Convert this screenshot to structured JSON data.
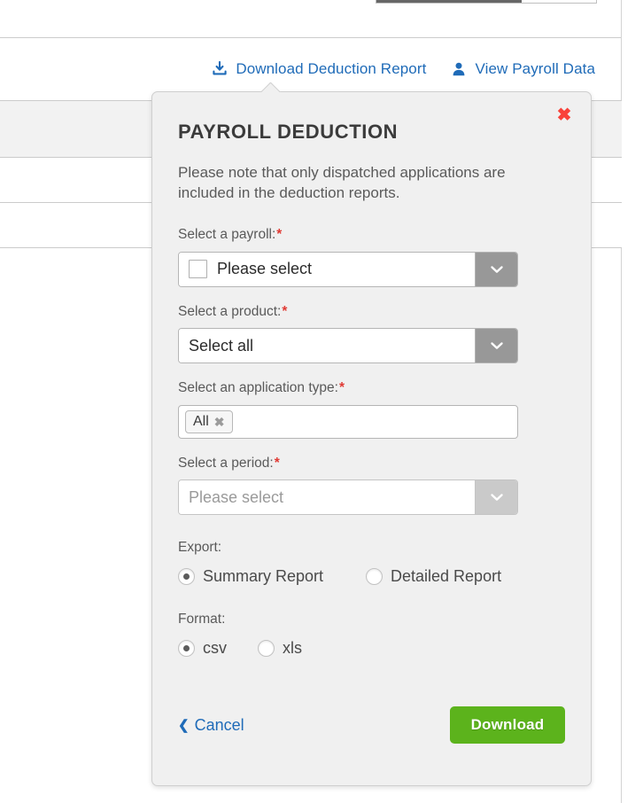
{
  "background": {
    "table_header_row": "",
    "table_rows": [
      "",
      ""
    ]
  },
  "actions": {
    "download_report": {
      "label": "Download Deduction Report",
      "icon": "download-icon"
    },
    "view_payroll": {
      "label": "View Payroll Data",
      "icon": "user-icon"
    },
    "link_color": "#1f6bb8"
  },
  "modal": {
    "title": "PAYROLL DEDUCTION",
    "close_icon": "close-icon",
    "close_color": "#f9423a",
    "note": "Please note that only dispatched applications are included in the deduction reports.",
    "required_marker": "*",
    "fields": {
      "payroll": {
        "label": "Select a payroll:",
        "required": true,
        "value": "Please select",
        "has_checkbox": true,
        "checkbox_checked": false,
        "disabled": false,
        "caret_icon": "chevron-down-icon"
      },
      "product": {
        "label": "Select a product:",
        "required": true,
        "value": "Select all",
        "has_checkbox": false,
        "disabled": false,
        "caret_icon": "chevron-down-icon"
      },
      "application_type": {
        "label": "Select an application type:",
        "required": true,
        "tokens": [
          {
            "label": "All",
            "remove_icon": "close-small-icon"
          }
        ]
      },
      "period": {
        "label": "Select a period:",
        "required": true,
        "value": "Please select",
        "placeholder": "Please select",
        "disabled": true,
        "caret_icon": "chevron-down-icon"
      }
    },
    "export": {
      "label": "Export:",
      "options": [
        {
          "label": "Summary Report",
          "selected": true
        },
        {
          "label": "Detailed Report",
          "selected": false
        }
      ]
    },
    "format": {
      "label": "Format:",
      "options": [
        {
          "label": "csv",
          "selected": true
        },
        {
          "label": "xls",
          "selected": false
        }
      ]
    },
    "footer": {
      "cancel_label": "Cancel",
      "cancel_chevron": "❮",
      "download_label": "Download",
      "download_color": "#5cb31c"
    }
  }
}
